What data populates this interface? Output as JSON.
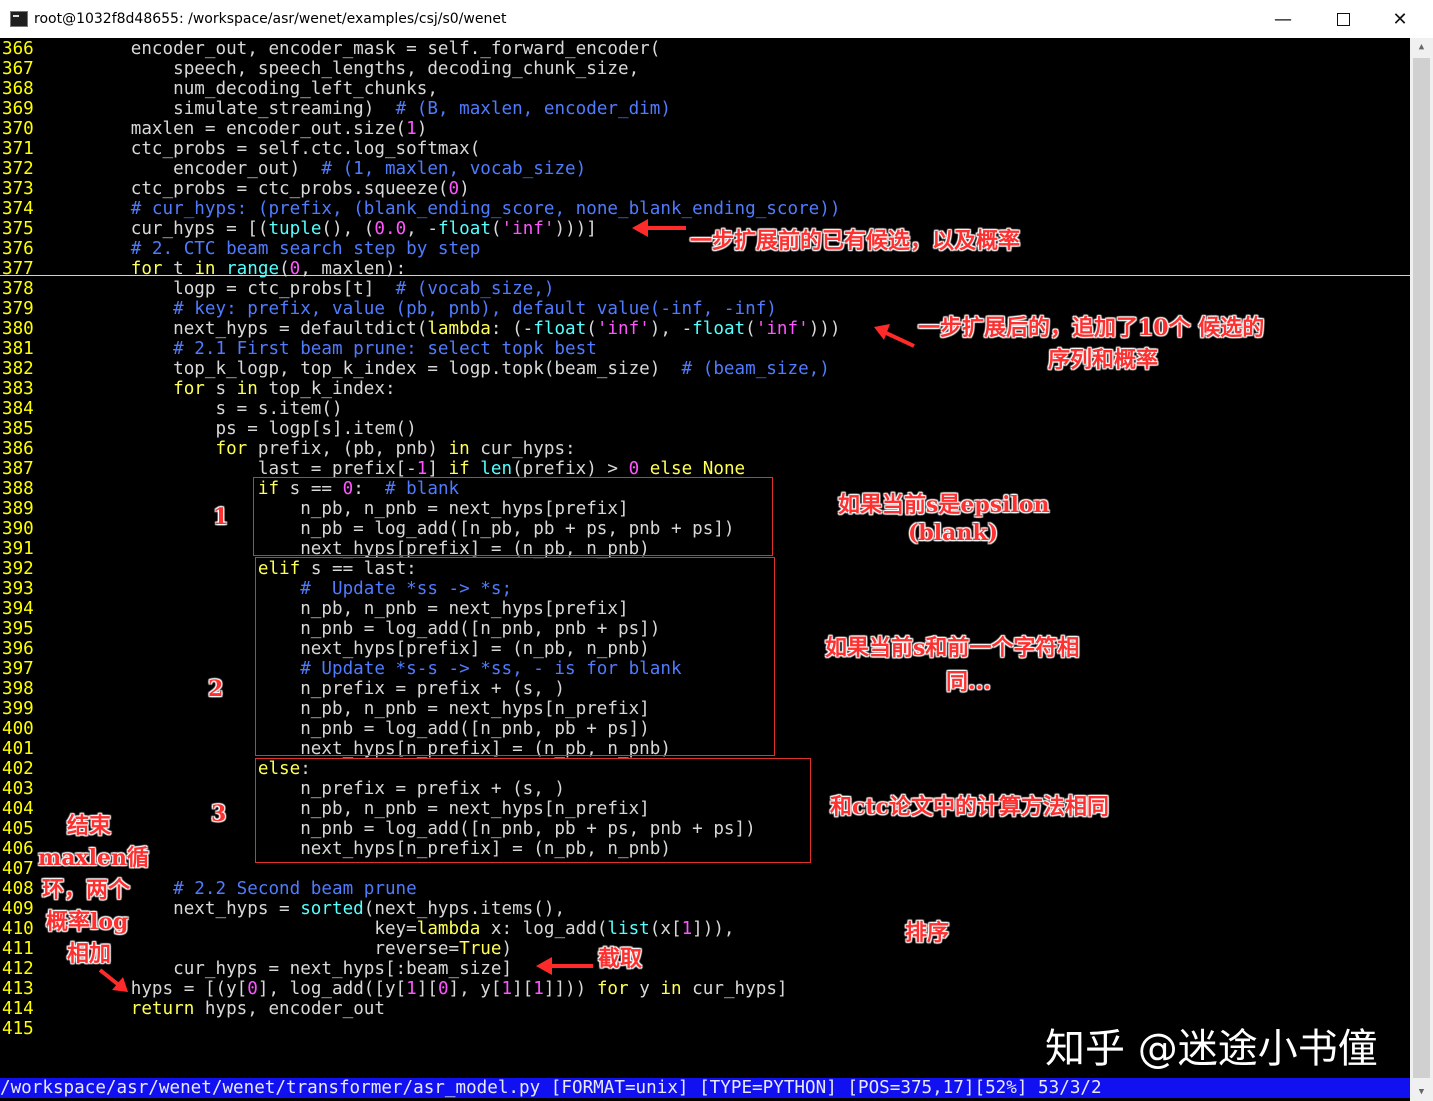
{
  "window": {
    "title": "root@1032f8d48655: /workspace/asr/wenet/examples/csj/s0/wenet",
    "minimize": "—",
    "close": "✕"
  },
  "lines": [
    {
      "n": "366",
      "code": "        encoder_out, encoder_mask = self._forward_encoder("
    },
    {
      "n": "367",
      "code": "            speech, speech_lengths, decoding_chunk_size,"
    },
    {
      "n": "368",
      "code": "            num_decoding_left_chunks,"
    },
    {
      "n": "369",
      "code": "            simulate_streaming)  # (B, maxlen, encoder_dim)"
    },
    {
      "n": "370",
      "code": "        maxlen = encoder_out.size(1)"
    },
    {
      "n": "371",
      "code": "        ctc_probs = self.ctc.log_softmax("
    },
    {
      "n": "372",
      "code": "            encoder_out)  # (1, maxlen, vocab_size)"
    },
    {
      "n": "373",
      "code": "        ctc_probs = ctc_probs.squeeze(0)"
    },
    {
      "n": "374",
      "code": "        # cur_hyps: (prefix, (blank_ending_score, none_blank_ending_score))"
    },
    {
      "n": "375",
      "code": "        cur_hyps = [(tuple(), (0.0, -float('inf')))]"
    },
    {
      "n": "376",
      "code": "        # 2. CTC beam search step by step"
    },
    {
      "n": "377",
      "code": "        for t in range(0, maxlen):"
    },
    {
      "n": "378",
      "code": "            logp = ctc_probs[t]  # (vocab_size,)"
    },
    {
      "n": "379",
      "code": "            # key: prefix, value (pb, pnb), default value(-inf, -inf)"
    },
    {
      "n": "380",
      "code": "            next_hyps = defaultdict(lambda: (-float('inf'), -float('inf')))"
    },
    {
      "n": "381",
      "code": "            # 2.1 First beam prune: select topk best"
    },
    {
      "n": "382",
      "code": "            top_k_logp, top_k_index = logp.topk(beam_size)  # (beam_size,)"
    },
    {
      "n": "383",
      "code": "            for s in top_k_index:"
    },
    {
      "n": "384",
      "code": "                s = s.item()"
    },
    {
      "n": "385",
      "code": "                ps = logp[s].item()"
    },
    {
      "n": "386",
      "code": "                for prefix, (pb, pnb) in cur_hyps:"
    },
    {
      "n": "387",
      "code": "                    last = prefix[-1] if len(prefix) > 0 else None"
    },
    {
      "n": "388",
      "code": "                    if s == 0:  # blank"
    },
    {
      "n": "389",
      "code": "                        n_pb, n_pnb = next_hyps[prefix]"
    },
    {
      "n": "390",
      "code": "                        n_pb = log_add([n_pb, pb + ps, pnb + ps])"
    },
    {
      "n": "391",
      "code": "                        next_hyps[prefix] = (n_pb, n_pnb)"
    },
    {
      "n": "392",
      "code": "                    elif s == last:"
    },
    {
      "n": "393",
      "code": "                        #  Update *ss -> *s;"
    },
    {
      "n": "394",
      "code": "                        n_pb, n_pnb = next_hyps[prefix]"
    },
    {
      "n": "395",
      "code": "                        n_pnb = log_add([n_pnb, pnb + ps])"
    },
    {
      "n": "396",
      "code": "                        next_hyps[prefix] = (n_pb, n_pnb)"
    },
    {
      "n": "397",
      "code": "                        # Update *s-s -> *ss, - is for blank"
    },
    {
      "n": "398",
      "code": "                        n_prefix = prefix + (s, )"
    },
    {
      "n": "399",
      "code": "                        n_pb, n_pnb = next_hyps[n_prefix]"
    },
    {
      "n": "400",
      "code": "                        n_pnb = log_add([n_pnb, pb + ps])"
    },
    {
      "n": "401",
      "code": "                        next_hyps[n_prefix] = (n_pb, n_pnb)"
    },
    {
      "n": "402",
      "code": "                    else:"
    },
    {
      "n": "403",
      "code": "                        n_prefix = prefix + (s, )"
    },
    {
      "n": "404",
      "code": "                        n_pb, n_pnb = next_hyps[n_prefix]"
    },
    {
      "n": "405",
      "code": "                        n_pnb = log_add([n_pnb, pb + ps, pnb + ps])"
    },
    {
      "n": "406",
      "code": "                        next_hyps[n_prefix] = (n_pb, n_pnb)"
    },
    {
      "n": "407",
      "code": ""
    },
    {
      "n": "408",
      "code": "            # 2.2 Second beam prune"
    },
    {
      "n": "409",
      "code": "            next_hyps = sorted(next_hyps.items(),"
    },
    {
      "n": "410",
      "code": "                               key=lambda x: log_add(list(x[1])),"
    },
    {
      "n": "411",
      "code": "                               reverse=True)"
    },
    {
      "n": "412",
      "code": "            cur_hyps = next_hyps[:beam_size]"
    },
    {
      "n": "413",
      "code": "        hyps = [(y[0], log_add([y[1][0], y[1][1]])) for y in cur_hyps]"
    },
    {
      "n": "414",
      "code": "        return hyps, encoder_out"
    },
    {
      "n": "415",
      "code": ""
    }
  ],
  "status_line": "/workspace/asr/wenet/wenet/transformer/asr_model.py [FORMAT=unix] [TYPE=PYTHON] [POS=375,17][52%] 53/3/2",
  "annotations": {
    "a375": "一步扩展前的已有候选，以及概率",
    "a380_1": "一步扩展后的，追加了10个 候选的",
    "a380_2": "序列和概率",
    "m1": "1",
    "m2": "2",
    "m3": "3",
    "n1_1": "如果当前s是epsilon",
    "n1_2": "(blank)",
    "n2_1": "如果当前s和前一个字符相",
    "n2_2": "同...",
    "n3": "和ctc论文中的计算方法相同",
    "sort": "排序",
    "trunc": "截取",
    "end1": "结束",
    "end2": "maxlen循",
    "end3": "环，两个",
    "end4": "概率log",
    "end5": "相加"
  },
  "watermark": "知乎 @迷途小书僮",
  "colors": {
    "line_number": "#ffff00",
    "keyword": "#ffff55",
    "builtin": "#55ffff",
    "number_string": "#ff55ff",
    "comment": "#4f7bff",
    "status_bg": "#1010f0",
    "annotation": "#ff3030"
  }
}
